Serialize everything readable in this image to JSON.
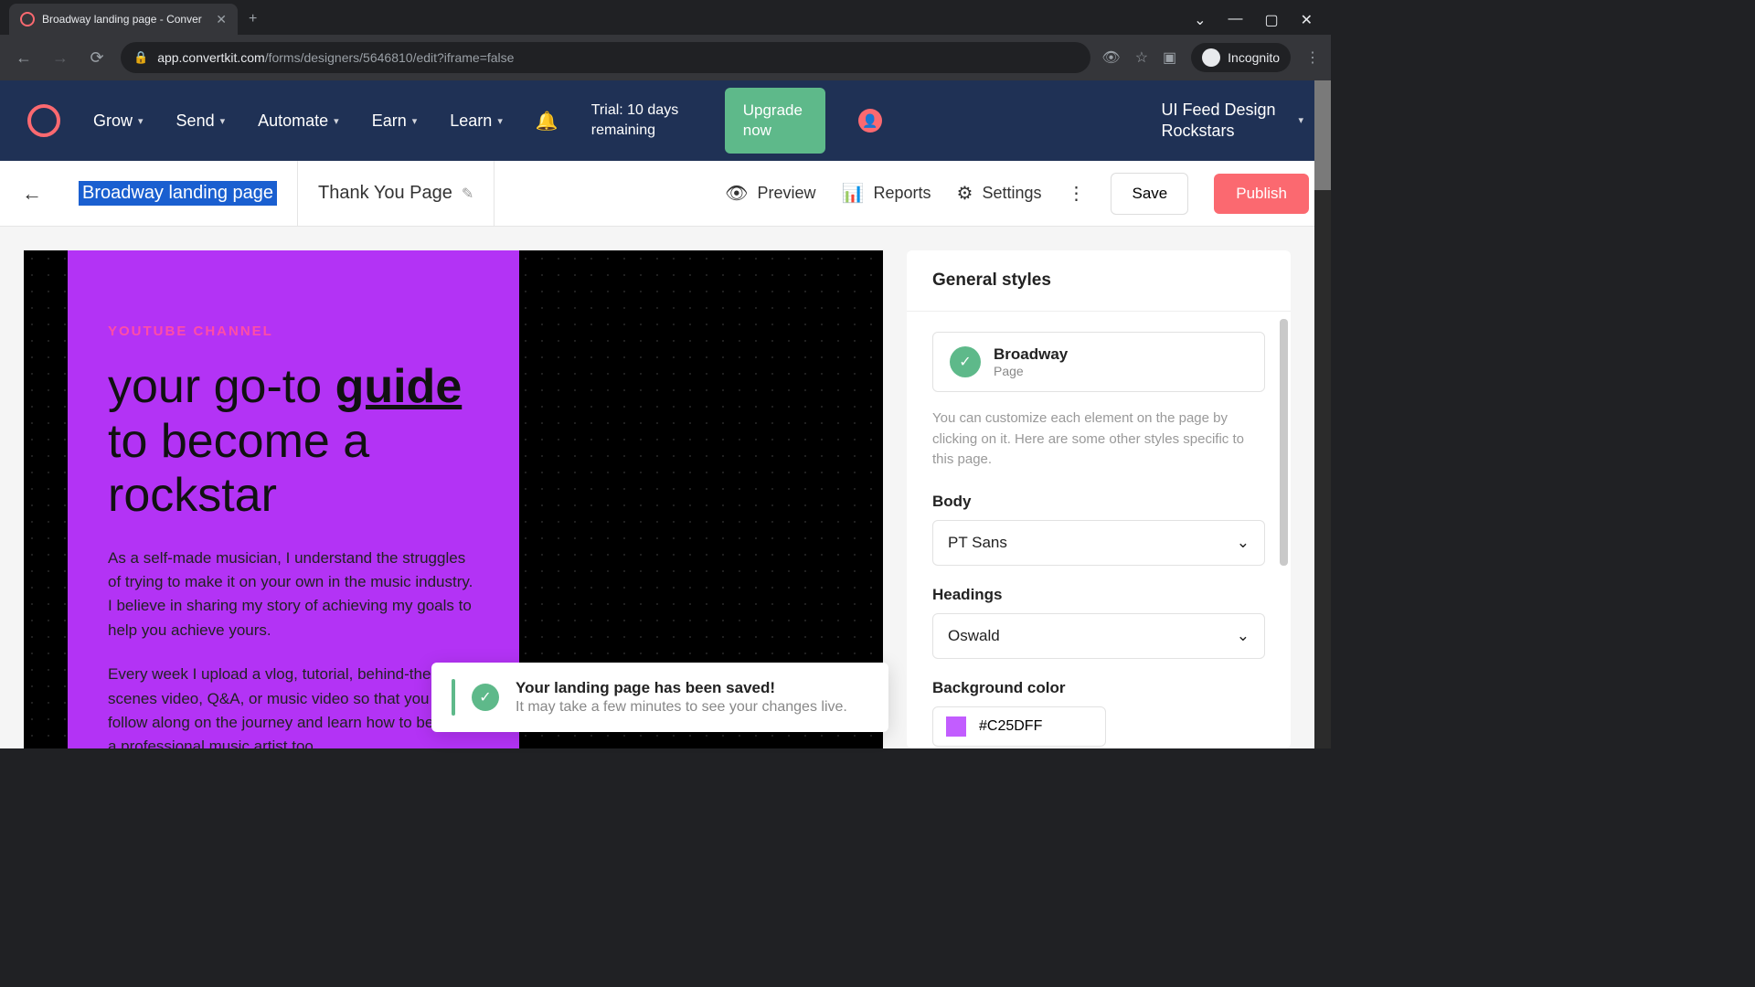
{
  "browser": {
    "tab_title": "Broadway landing page - Conver",
    "url_domain": "app.convertkit.com",
    "url_path": "/forms/designers/5646810/edit?iframe=false",
    "incognito": "Incognito"
  },
  "nav": {
    "items": [
      "Grow",
      "Send",
      "Automate",
      "Earn",
      "Learn"
    ],
    "trial": "Trial: 10 days remaining",
    "upgrade": "Upgrade now",
    "account": "UI Feed Design Rockstars"
  },
  "editor": {
    "page_name": "Broadway landing page",
    "secondary_tab": "Thank You Page",
    "preview": "Preview",
    "reports": "Reports",
    "settings": "Settings",
    "save": "Save",
    "publish": "Publish"
  },
  "canvas": {
    "eyebrow": "YOUTUBE CHANNEL",
    "headline_1": "your go-to ",
    "headline_u": "guide",
    "headline_2": " to become a rockstar",
    "p1": "As a self-made musician, I understand the struggles of trying to make it on your own in the music industry. I believe in sharing my story of achieving my goals to help you achieve yours.",
    "p2": "Every week I upload a vlog, tutorial, behind-the-scenes video, Q&A, or music video so that you can follow along on the journey and learn how to become a professional music artist too."
  },
  "toast": {
    "title": "Your landing page has been saved!",
    "body": "It may take a few minutes to see your changes live."
  },
  "sidebar": {
    "title": "General styles",
    "template_name": "Broadway",
    "template_sub": "Page",
    "help": "You can customize each element on the page by clicking on it. Here are some other styles specific to this page.",
    "body_label": "Body",
    "body_font": "PT Sans",
    "headings_label": "Headings",
    "headings_font": "Oswald",
    "bg_label": "Background color",
    "bg_value": "#C25DFF"
  }
}
